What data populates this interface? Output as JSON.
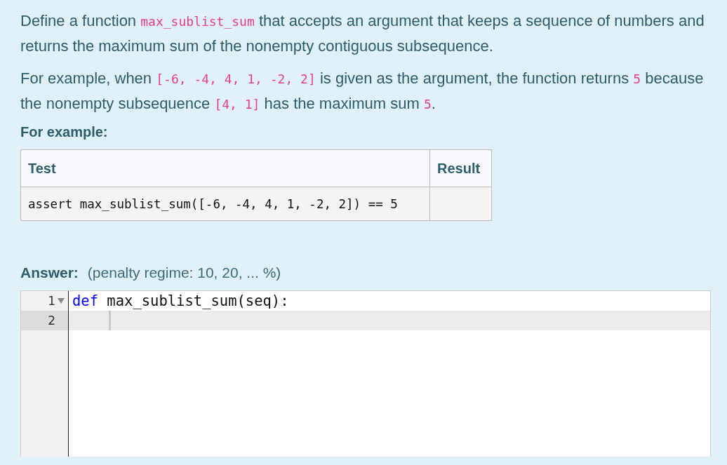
{
  "paragraphs": [
    [
      {
        "kind": "text",
        "text": "Define a function "
      },
      {
        "kind": "code",
        "text": "max_sublist_sum"
      },
      {
        "kind": "text",
        "text": " that accepts an argument that keeps a sequence of numbers and returns the maximum sum of the nonempty contiguous subsequence."
      }
    ],
    [
      {
        "kind": "text",
        "text": "For example, when "
      },
      {
        "kind": "code",
        "text": "[-6, -4, 4, 1, -2, 2]"
      },
      {
        "kind": "text",
        "text": " is given as the argument, the function returns "
      },
      {
        "kind": "code",
        "text": "5"
      },
      {
        "kind": "text",
        "text": " because the nonempty subsequence "
      },
      {
        "kind": "code",
        "text": "[4, 1]"
      },
      {
        "kind": "text",
        "text": " has the maximum sum "
      },
      {
        "kind": "code",
        "text": "5"
      },
      {
        "kind": "text",
        "text": "."
      }
    ]
  ],
  "example_heading": "For example:",
  "table": {
    "columns": [
      "Test",
      "Result"
    ],
    "rows": [
      [
        "assert max_sublist_sum([-6, -4, 4, 1, -2, 2]) == 5",
        ""
      ]
    ]
  },
  "answer": {
    "label": "Answer:",
    "penalty": "(penalty regime: 10, 20, ... %)"
  },
  "editor": {
    "lines": [
      {
        "number": "1",
        "expanded": true,
        "selected": false,
        "tokens": [
          {
            "kind": "keyword",
            "text": "def"
          },
          {
            "kind": "plain",
            "text": " max_sublist_sum(seq):"
          }
        ]
      },
      {
        "number": "2",
        "selected": true
      }
    ]
  }
}
